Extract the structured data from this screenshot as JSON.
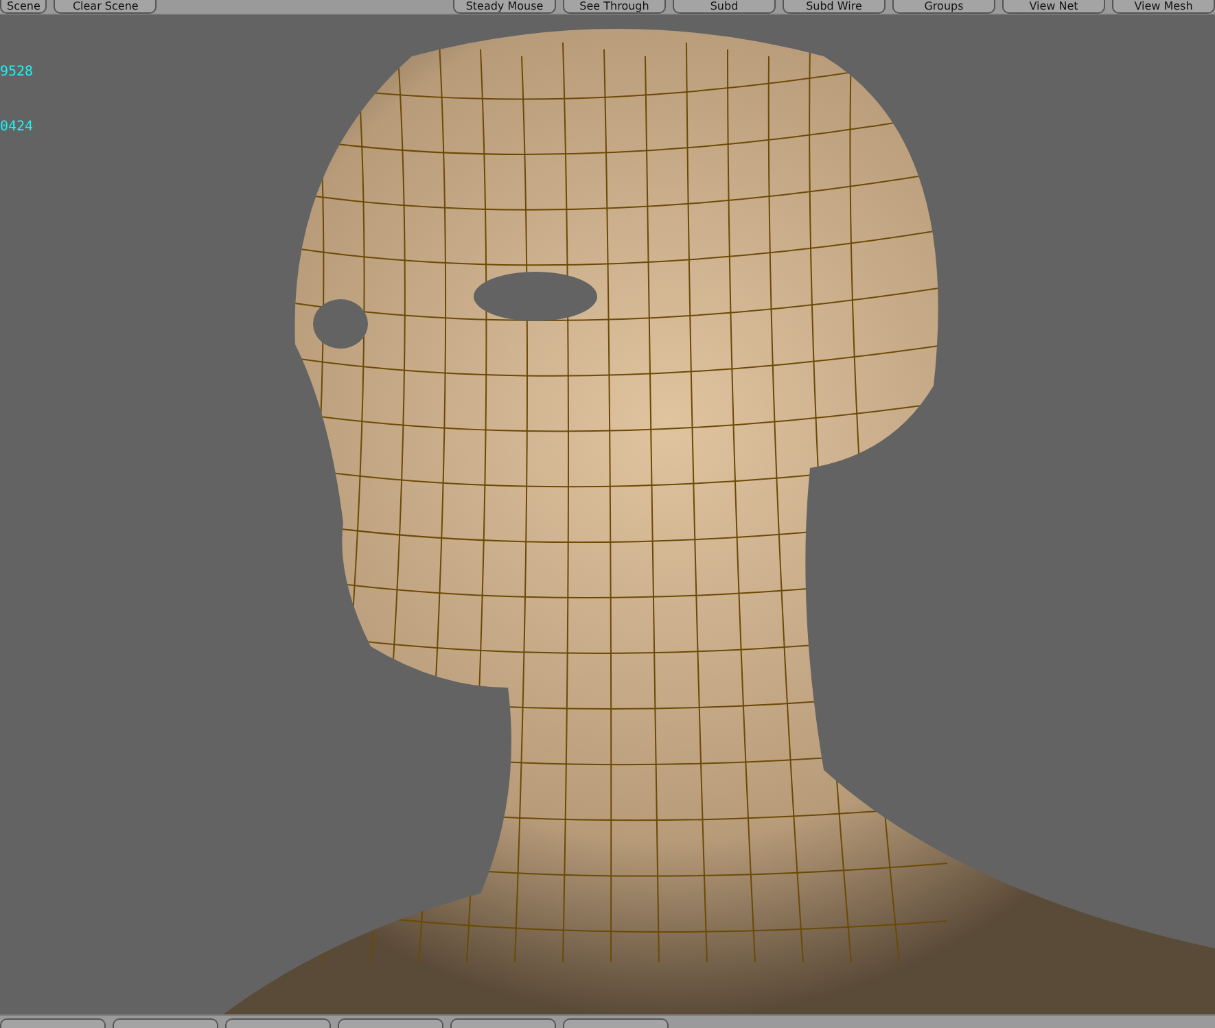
{
  "top_toolbar": {
    "left_buttons": [
      "Scene",
      "Clear Scene"
    ],
    "right_buttons": [
      "Steady Mouse",
      "See Through",
      "Subd",
      "Subd Wire",
      "Groups",
      "View Net",
      "View Mesh"
    ]
  },
  "viewport": {
    "stats": [
      "9528",
      "0424"
    ]
  }
}
